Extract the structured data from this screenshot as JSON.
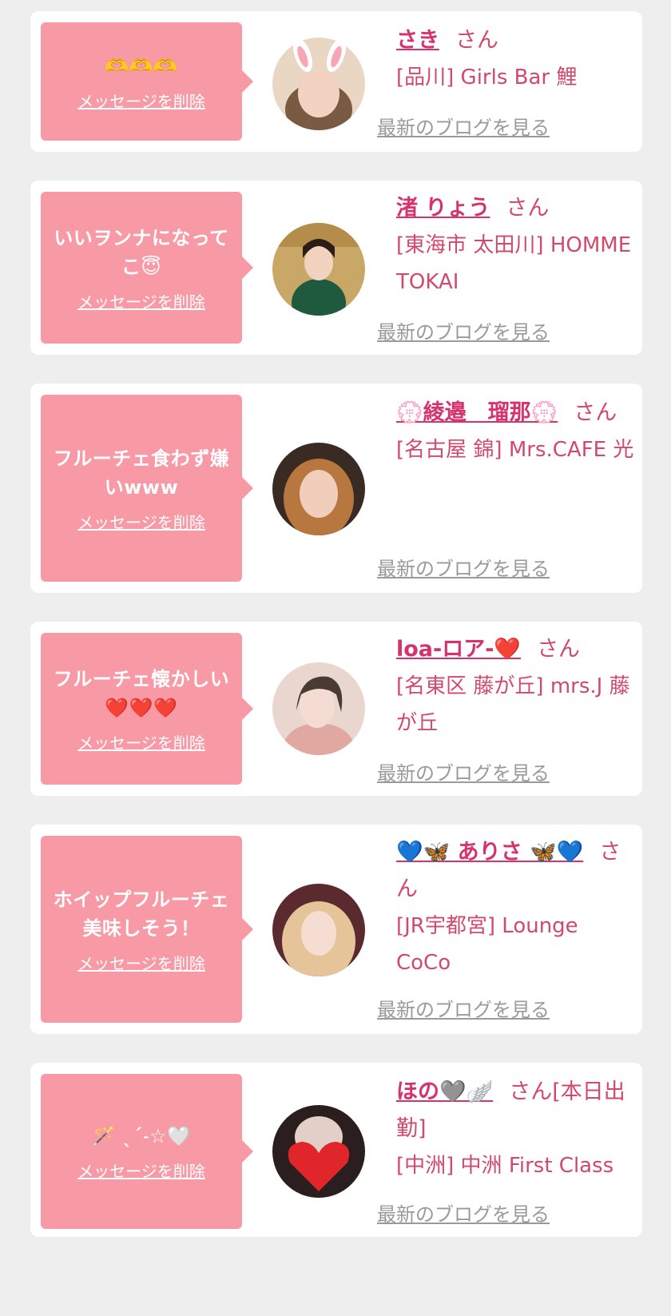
{
  "delete_label": "メッセージを削除",
  "blog_label": "最新のブログを見る",
  "honorific": "さん",
  "colors": {
    "background": "#eeeeee",
    "card": "#ffffff",
    "bubble": "#f79aa6",
    "name_text": "#d6336c",
    "shop_text": "#d24a6b",
    "link_gray": "#9a9a9a"
  },
  "items": [
    {
      "message": "🫶🫶🫶",
      "name": "さき",
      "suffix": "",
      "shop": "[品川] Girls Bar 鯉",
      "avatar_icon": "avatar-photo-bunny-ears"
    },
    {
      "message": "いいヲンナになってこ😇",
      "name": "渚 りょう",
      "suffix": "",
      "shop": "[東海市 太田川] HOMME TOKAI",
      "avatar_icon": "avatar-photo"
    },
    {
      "message": "フルーチェ食わず嫌いwww",
      "name": "💮綾邉　瑠那💮",
      "suffix": "",
      "shop": "[名古屋 錦] Mrs.CAFE 光",
      "avatar_icon": "avatar-photo"
    },
    {
      "message": "フルーチェ懐かしい❤️❤️❤️",
      "name": "loa-ロア-❤️",
      "suffix": "",
      "shop": "[名東区 藤が丘] mrs.J 藤が丘",
      "avatar_icon": "avatar-photo"
    },
    {
      "message": "ホイップフルーチェ美味しそう！",
      "name": "💙🦋 ありさ 🦋💙",
      "suffix": "",
      "shop": "[JR宇都宮] Lounge CoCo",
      "avatar_icon": "avatar-photo"
    },
    {
      "message": "🪄 ˎˊ˗☆🤍",
      "name": "ほの🩶🪽",
      "suffix": "[本日出勤]",
      "shop": "[中洲] 中洲 First Class",
      "avatar_icon": "avatar-photo-heart"
    }
  ]
}
